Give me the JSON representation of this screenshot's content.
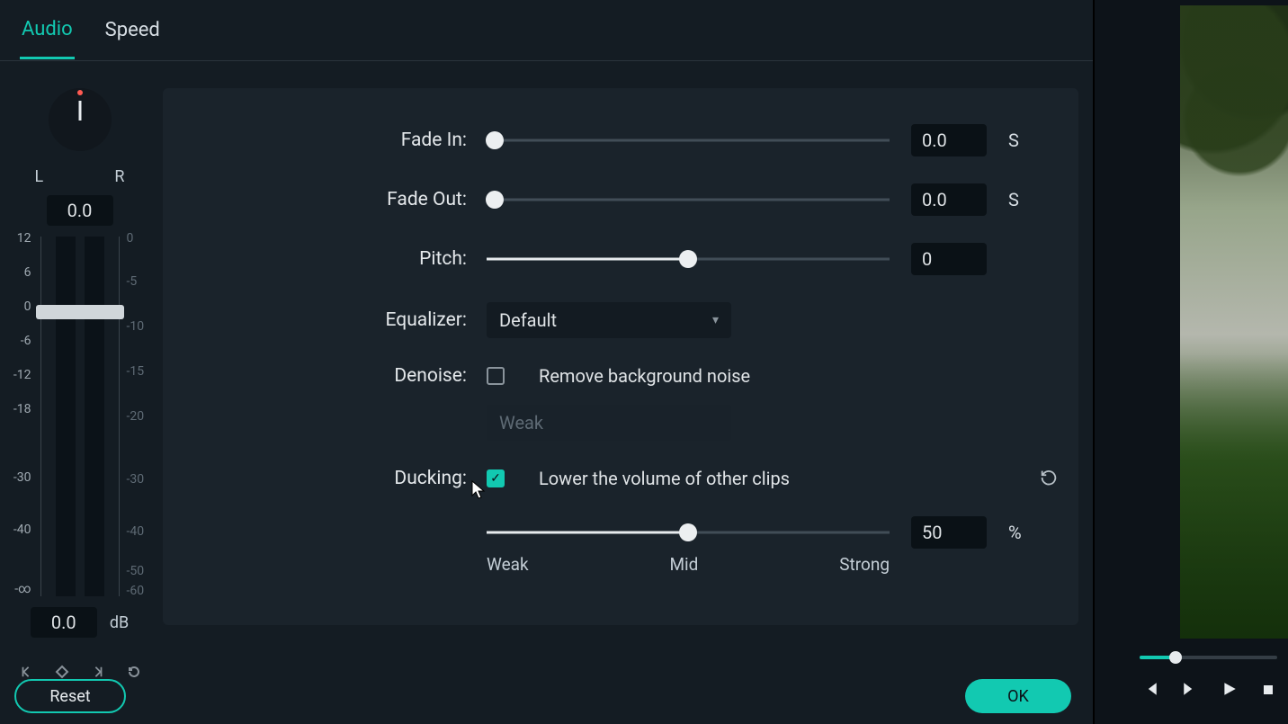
{
  "tabs": {
    "audio": "Audio",
    "speed": "Speed"
  },
  "pan": {
    "L": "L",
    "R": "R",
    "value": "0.0"
  },
  "meter": {
    "ticksL": [
      "12",
      "6",
      "0",
      "-6",
      "-12",
      "-18",
      "-30",
      "-40",
      "-∞"
    ],
    "ticksR": [
      "0",
      "-5",
      "-10",
      "-15",
      "-20",
      "-30",
      "-40",
      "-50",
      "-60"
    ],
    "thumb_pct": 19
  },
  "db": {
    "value": "0.0",
    "unit": "dB"
  },
  "fade_in": {
    "label": "Fade In:",
    "value": "0.0",
    "unit": "S",
    "pct": 0
  },
  "fade_out": {
    "label": "Fade Out:",
    "value": "0.0",
    "unit": "S",
    "pct": 0
  },
  "pitch": {
    "label": "Pitch:",
    "value": "0",
    "pct": 50
  },
  "equalizer": {
    "label": "Equalizer:",
    "selected": "Default"
  },
  "denoise": {
    "label": "Denoise:",
    "cb_label": "Remove background noise",
    "checked": false,
    "strength": "Weak"
  },
  "ducking": {
    "label": "Ducking:",
    "cb_label": "Lower the volume of other clips",
    "checked": true,
    "value": "50",
    "unit": "%",
    "pct": 50,
    "marks": {
      "weak": "Weak",
      "mid": "Mid",
      "strong": "Strong"
    }
  },
  "buttons": {
    "reset": "Reset",
    "ok": "OK"
  },
  "preview": {
    "progress_pct": 26
  }
}
